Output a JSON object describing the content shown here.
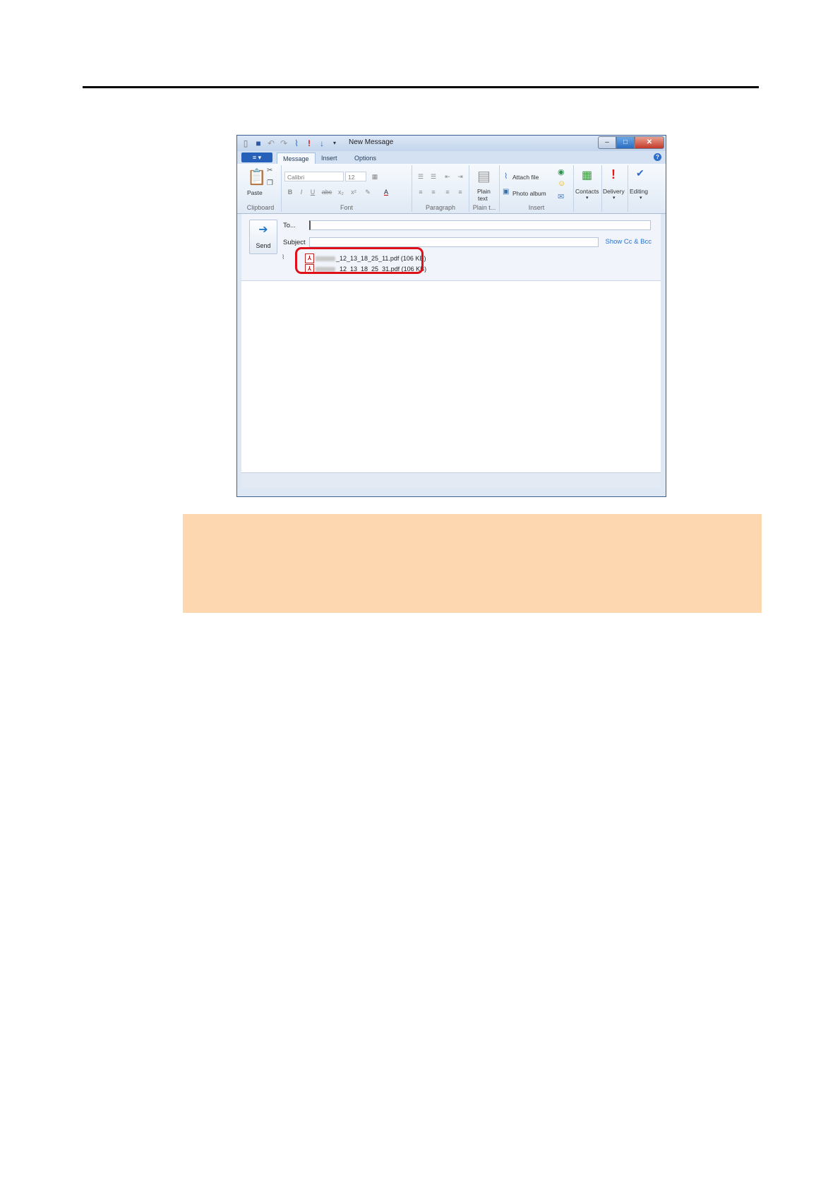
{
  "window": {
    "title": "New Message"
  },
  "tabs": [
    {
      "label": "Message"
    },
    {
      "label": "Insert"
    },
    {
      "label": "Options"
    }
  ],
  "ribbon": {
    "paste_label": "Paste",
    "clipboard_label": "Clipboard",
    "font_name": "Calibri",
    "font_size": "12",
    "font_label": "Font",
    "paragraph_label": "Paragraph",
    "plain_text_label_1": "Plain",
    "plain_text_label_2": "text",
    "plain_group_label": "Plain t...",
    "attach_file_label": "Attach file",
    "photo_album_label": "Photo album",
    "insert_label": "Insert",
    "contacts_label": "Contacts",
    "delivery_label": "Delivery",
    "editing_label": "Editing"
  },
  "compose": {
    "send_label": "Send",
    "to_label": "To...",
    "to_value": "",
    "subject_label": "Subject",
    "subject_value": "",
    "show_cc_bcc": "Show Cc & Bcc",
    "attachments": [
      {
        "name": "_12_13_18_25_11.pdf (106 KB)"
      },
      {
        "name": "_12_13_18_25_31.pdf (106 KB)"
      }
    ]
  },
  "colors": {
    "highlight_ring": "#e0101a",
    "note_background": "#fdd7b0"
  }
}
